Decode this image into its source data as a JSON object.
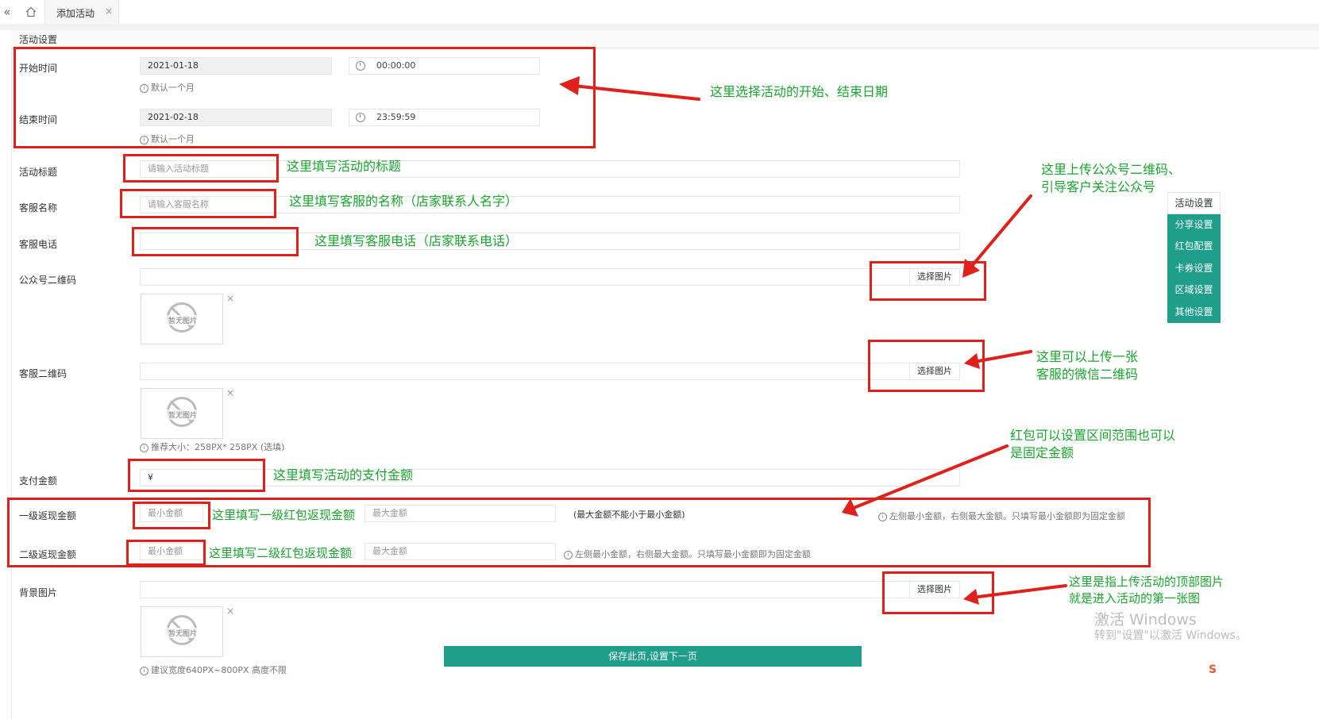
{
  "tabs": {
    "back_icon": "«",
    "home_icon": "home-icon",
    "active_tab": "添加活动",
    "close_icon": "×"
  },
  "section_title": "活动设置",
  "form": {
    "start_time_label": "开始时间",
    "start_date": "2021-01-18",
    "start_clock": "00:00:00",
    "start_hint": "默认一个月",
    "end_time_label": "结束时间",
    "end_date": "2021-02-18",
    "end_clock": "23:59:59",
    "end_hint": "默认一个月",
    "title_label": "活动标题",
    "title_placeholder": "请输入活动标题",
    "cs_name_label": "客服名称",
    "cs_name_placeholder": "请输入客服名称",
    "cs_phone_label": "客服电话",
    "qr_official_label": "公众号二维码",
    "qr_cs_label": "客服二维码",
    "pick_image": "选择图片",
    "no_image": "暂无图片",
    "qr_size_hint": "推荐大小：258PX* 258PX (选填)",
    "pay_label": "支付金额",
    "pay_value": "¥",
    "level1_label": "一级返现金额",
    "level2_label": "二级返现金额",
    "min_placeholder": "最小金额",
    "max_placeholder": "最大金额",
    "max_rule": "(最大金额不能小于最小金额)",
    "amount_hint": "左侧最小金额，右侧最大金额。只填写最小金额即为固定金额",
    "bg_label": "背景图片",
    "bg_hint": "建议宽度640PX~800PX 高度不限"
  },
  "side_nav": [
    "活动设置",
    "分享设置",
    "红包配置",
    "卡券设置",
    "区域设置",
    "其他设置"
  ],
  "save_button": "保存此页,设置下一页",
  "annotations": {
    "dates": "这里选择活动的开始、结束日期",
    "title": "这里填写活动的标题",
    "cs_name": "这里填写客服的名称（店家联系人名字）",
    "cs_phone": "这里填写客服电话（店家联系电话）",
    "qr_official_1": "这里上传公众号二维码、",
    "qr_official_2": "引导客户关注公众号",
    "qr_cs_1": "这里可以上传一张",
    "qr_cs_2": "客服的微信二维码",
    "redpack_1": "红包可以设置区间范围也可以",
    "redpack_2": "是固定金额",
    "pay": "这里填写活动的支付金额",
    "level1": "这里填写一级红包返现金额",
    "level2": "这里填写二级红包返现金额",
    "bg_1": "这里是指上传活动的顶部图片",
    "bg_2": "就是进入活动的第一张图"
  },
  "watermark": {
    "line1": "激活 Windows",
    "line2": "转到\"设置\"以激活 Windows。"
  },
  "ime_icon": "S",
  "colors": {
    "accent": "#1e9e8b",
    "annotation": "#1aa52e",
    "highlight": "#e0201b"
  }
}
